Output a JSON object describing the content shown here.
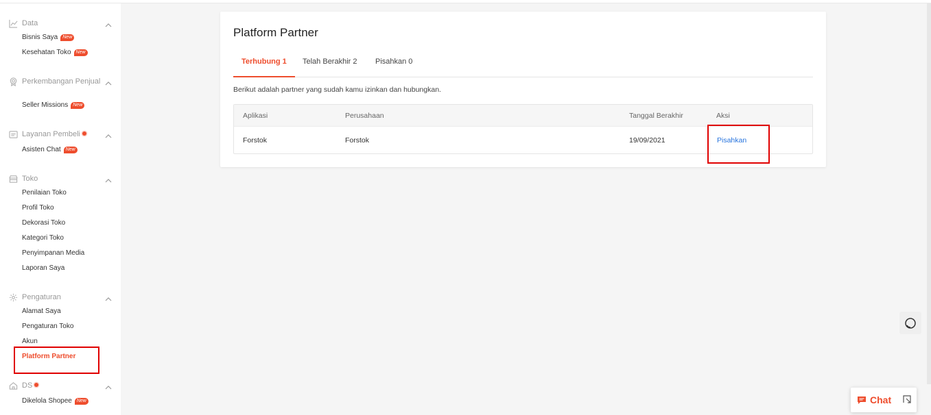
{
  "sidebar": {
    "sections": [
      {
        "title": "Data",
        "items": [
          {
            "label": "Bisnis Saya",
            "badge": "New"
          },
          {
            "label": "Kesehatan Toko",
            "badge": "New"
          }
        ]
      },
      {
        "title": "Perkembangan Penjual",
        "items": [
          {
            "label": "Seller Missions",
            "badge": "New"
          }
        ]
      },
      {
        "title": "Layanan Pembeli",
        "items": [
          {
            "label": "Asisten Chat",
            "badge": "New"
          }
        ]
      },
      {
        "title": "Toko",
        "items": [
          {
            "label": "Penilaian Toko"
          },
          {
            "label": "Profil Toko"
          },
          {
            "label": "Dekorasi Toko"
          },
          {
            "label": "Kategori Toko"
          },
          {
            "label": "Penyimpanan Media"
          },
          {
            "label": "Laporan Saya"
          }
        ]
      },
      {
        "title": "Pengaturan",
        "items": [
          {
            "label": "Alamat Saya"
          },
          {
            "label": "Pengaturan Toko"
          },
          {
            "label": "Akun"
          },
          {
            "label": "Platform Partner"
          }
        ]
      },
      {
        "title": "DS",
        "items": [
          {
            "label": "Dikelola Shopee",
            "badge": "New"
          }
        ]
      }
    ]
  },
  "main": {
    "title": "Platform Partner",
    "tabs": [
      {
        "label": "Terhubung 1",
        "active": true
      },
      {
        "label": "Telah Berakhir 2"
      },
      {
        "label": "Pisahkan 0"
      }
    ],
    "description": "Berikut adalah partner yang sudah kamu izinkan dan hubungkan.",
    "table": {
      "columns": [
        "Aplikasi",
        "Perusahaan",
        "Tanggal Berakhir",
        "Aksi"
      ],
      "rows": [
        {
          "aplikasi": "Forstok",
          "perusahaan": "Forstok",
          "tanggal": "19/09/2021",
          "aksi": "Pisahkan"
        }
      ]
    }
  },
  "chat_widget": {
    "label": "Chat"
  },
  "colors": {
    "accent": "#ee4d2d",
    "link": "#2673dd",
    "highlight_box": "#e00000"
  }
}
